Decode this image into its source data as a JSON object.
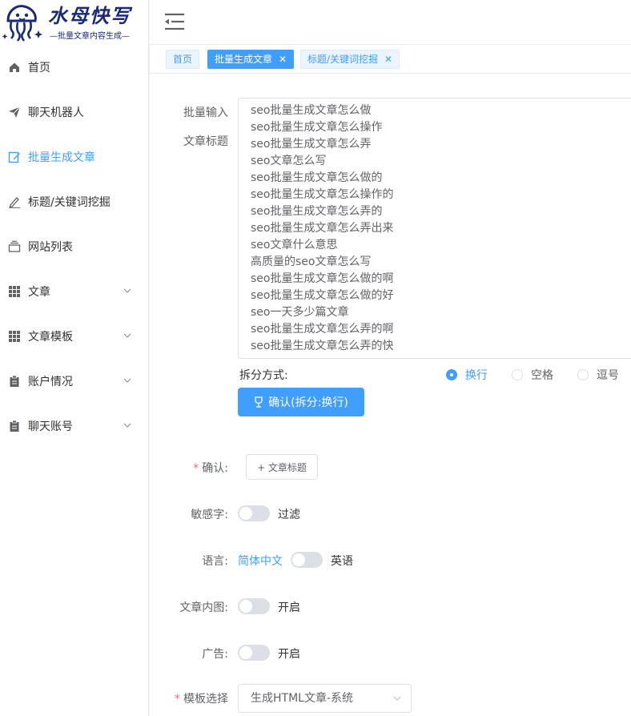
{
  "app": {
    "title": "水母快写",
    "subtitle": "—批量文章内容生成—"
  },
  "sidebar": {
    "items": [
      {
        "label": "首页",
        "icon": "home-icon"
      },
      {
        "label": "聊天机器人",
        "icon": "send-icon"
      },
      {
        "label": "批量生成文章",
        "icon": "edit-icon",
        "active": true
      },
      {
        "label": "标题/关键词挖掘",
        "icon": "pen-icon"
      },
      {
        "label": "网站列表",
        "icon": "layers-icon"
      },
      {
        "label": "文章",
        "icon": "grid-icon",
        "expandable": true
      },
      {
        "label": "文章模板",
        "icon": "grid-icon",
        "expandable": true
      },
      {
        "label": "账户情况",
        "icon": "clipboard-icon",
        "expandable": true
      },
      {
        "label": "聊天账号",
        "icon": "clipboard-icon",
        "expandable": true
      }
    ]
  },
  "tabs": [
    {
      "label": "首页",
      "closable": false
    },
    {
      "label": "批量生成文章",
      "closable": true,
      "active": true
    },
    {
      "label": "标题/关键词挖掘",
      "closable": true
    }
  ],
  "form": {
    "batch_input_label": "批量输入",
    "title_label": "文章标题",
    "titles": [
      "seo批量生成文章怎么做",
      "seo批量生成文章怎么操作",
      "seo批量生成文章怎么弄",
      "seo文章怎么写",
      "seo批量生成文章怎么做的",
      "seo批量生成文章怎么操作的",
      "seo批量生成文章怎么弄的",
      "seo批量生成文章怎么弄出来",
      "seo文章什么意思",
      "高质量的seo文章怎么写",
      "seo批量生成文章怎么做的啊",
      "seo批量生成文章怎么做的好",
      "seo一天多少篇文章",
      "seo批量生成文章怎么弄的啊",
      "seo批量生成文章怎么弄的快"
    ],
    "split_label": "拆分方式:",
    "split_options": [
      "换行",
      "空格",
      "逗号"
    ],
    "split_selected": "换行",
    "confirm_split_button": "确认(拆分:换行)",
    "confirm_label": "确认:",
    "add_title_button": "+ 文章标题",
    "sensitive_label": "敏感字:",
    "sensitive_text": "过滤",
    "language_label": "语言:",
    "language_left": "简体中文",
    "language_right": "英语",
    "inner_image_label": "文章内图:",
    "inner_image_text": "开启",
    "ads_label": "广告:",
    "ads_text": "开启",
    "template_label": "模板选择",
    "template_value": "生成HTML文章-系统"
  },
  "colors": {
    "primary": "#409eff",
    "brand": "#1a2a7a",
    "required": "#f56c6c"
  }
}
